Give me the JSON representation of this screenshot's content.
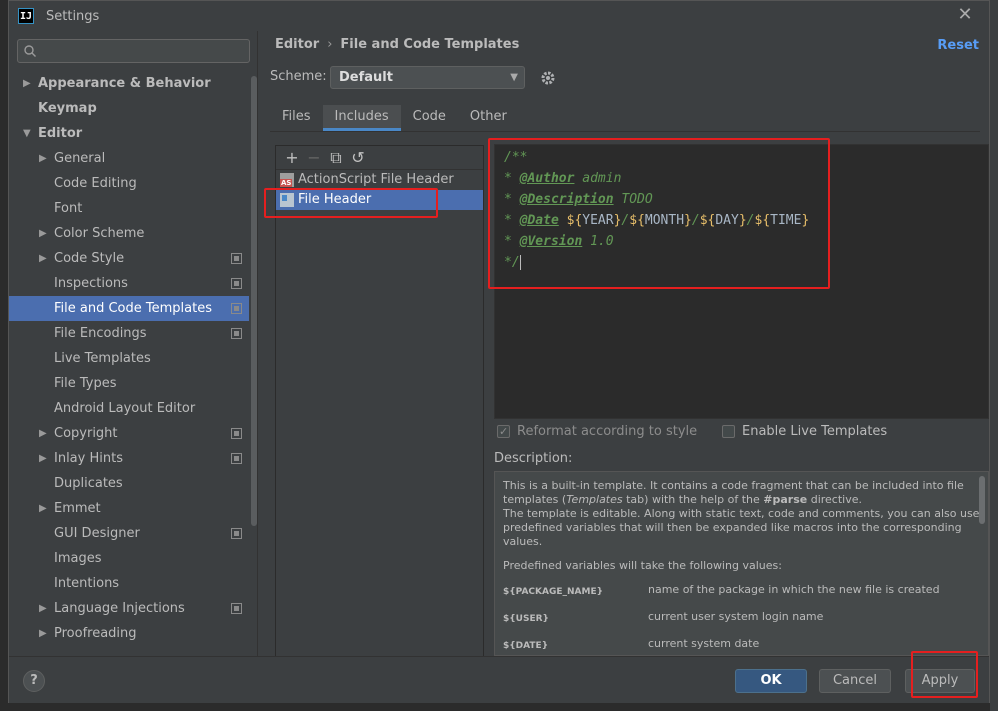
{
  "window": {
    "title": "Settings",
    "app_icon_text": "IJ"
  },
  "search": {
    "placeholder": ""
  },
  "sidebar": {
    "items": [
      {
        "label": "Appearance & Behavior",
        "level": 0,
        "arrow": "right",
        "bold": true,
        "icon": false,
        "selected": false
      },
      {
        "label": "Keymap",
        "level": 0,
        "arrow": "",
        "bold": true,
        "icon": false,
        "selected": false
      },
      {
        "label": "Editor",
        "level": 0,
        "arrow": "down",
        "bold": true,
        "icon": false,
        "selected": false
      },
      {
        "label": "General",
        "level": 1,
        "arrow": "right",
        "bold": false,
        "icon": false,
        "selected": false
      },
      {
        "label": "Code Editing",
        "level": 1,
        "arrow": "",
        "bold": false,
        "icon": false,
        "selected": false
      },
      {
        "label": "Font",
        "level": 1,
        "arrow": "",
        "bold": false,
        "icon": false,
        "selected": false
      },
      {
        "label": "Color Scheme",
        "level": 1,
        "arrow": "right",
        "bold": false,
        "icon": false,
        "selected": false
      },
      {
        "label": "Code Style",
        "level": 1,
        "arrow": "right",
        "bold": false,
        "icon": true,
        "selected": false
      },
      {
        "label": "Inspections",
        "level": 1,
        "arrow": "",
        "bold": false,
        "icon": true,
        "selected": false
      },
      {
        "label": "File and Code Templates",
        "level": 1,
        "arrow": "",
        "bold": false,
        "icon": true,
        "selected": true
      },
      {
        "label": "File Encodings",
        "level": 1,
        "arrow": "",
        "bold": false,
        "icon": true,
        "selected": false
      },
      {
        "label": "Live Templates",
        "level": 1,
        "arrow": "",
        "bold": false,
        "icon": false,
        "selected": false
      },
      {
        "label": "File Types",
        "level": 1,
        "arrow": "",
        "bold": false,
        "icon": false,
        "selected": false
      },
      {
        "label": "Android Layout Editor",
        "level": 1,
        "arrow": "",
        "bold": false,
        "icon": false,
        "selected": false
      },
      {
        "label": "Copyright",
        "level": 1,
        "arrow": "right",
        "bold": false,
        "icon": true,
        "selected": false
      },
      {
        "label": "Inlay Hints",
        "level": 1,
        "arrow": "right",
        "bold": false,
        "icon": true,
        "selected": false
      },
      {
        "label": "Duplicates",
        "level": 1,
        "arrow": "",
        "bold": false,
        "icon": false,
        "selected": false
      },
      {
        "label": "Emmet",
        "level": 1,
        "arrow": "right",
        "bold": false,
        "icon": false,
        "selected": false
      },
      {
        "label": "GUI Designer",
        "level": 1,
        "arrow": "",
        "bold": false,
        "icon": true,
        "selected": false
      },
      {
        "label": "Images",
        "level": 1,
        "arrow": "",
        "bold": false,
        "icon": false,
        "selected": false
      },
      {
        "label": "Intentions",
        "level": 1,
        "arrow": "",
        "bold": false,
        "icon": false,
        "selected": false
      },
      {
        "label": "Language Injections",
        "level": 1,
        "arrow": "right",
        "bold": false,
        "icon": true,
        "selected": false
      },
      {
        "label": "Proofreading",
        "level": 1,
        "arrow": "right",
        "bold": false,
        "icon": false,
        "selected": false
      }
    ]
  },
  "header": {
    "crumb_1": "Editor",
    "crumb_sep": "›",
    "crumb_2": "File and Code Templates",
    "reset": "Reset"
  },
  "scheme": {
    "label": "Scheme:",
    "value": "Default"
  },
  "tabs": [
    {
      "label": "Files",
      "active": false
    },
    {
      "label": "Includes",
      "active": true
    },
    {
      "label": "Code",
      "active": false
    },
    {
      "label": "Other",
      "active": false
    }
  ],
  "templates": [
    {
      "label": "ActionScript File Header",
      "icon": "actionscript-file-icon",
      "selected": false
    },
    {
      "label": "File Header",
      "icon": "file-header-icon",
      "selected": true
    }
  ],
  "editor": {
    "lines": [
      [
        {
          "t": "/**",
          "c": "c-comment"
        }
      ],
      [
        {
          "t": "* ",
          "c": "c-comment"
        },
        {
          "t": "@Author",
          "c": "c-tag"
        },
        {
          "t": " admin",
          "c": "c-comment"
        }
      ],
      [
        {
          "t": "* ",
          "c": "c-comment"
        },
        {
          "t": "@Description",
          "c": "c-tag"
        },
        {
          "t": " TODO",
          "c": "c-comment"
        }
      ],
      [
        {
          "t": "* ",
          "c": "c-comment"
        },
        {
          "t": "@Date",
          "c": "c-tag"
        },
        {
          "t": " ",
          "c": "c-comment"
        },
        {
          "t": "${",
          "c": "c-var"
        },
        {
          "t": "YEAR",
          "c": "c-plain"
        },
        {
          "t": "}",
          "c": "c-var"
        },
        {
          "t": "/",
          "c": "c-comment"
        },
        {
          "t": "${",
          "c": "c-var"
        },
        {
          "t": "MONTH",
          "c": "c-plain"
        },
        {
          "t": "}",
          "c": "c-var"
        },
        {
          "t": "/",
          "c": "c-comment"
        },
        {
          "t": "${",
          "c": "c-var"
        },
        {
          "t": "DAY",
          "c": "c-plain"
        },
        {
          "t": "}",
          "c": "c-var"
        },
        {
          "t": "/",
          "c": "c-comment"
        },
        {
          "t": "${",
          "c": "c-var"
        },
        {
          "t": "TIME",
          "c": "c-plain"
        },
        {
          "t": "}",
          "c": "c-var"
        }
      ],
      [
        {
          "t": "* ",
          "c": "c-comment"
        },
        {
          "t": "@Version",
          "c": "c-tag"
        },
        {
          "t": " 1.0",
          "c": "c-comment"
        }
      ],
      [
        {
          "t": "*/",
          "c": "c-comment"
        }
      ]
    ]
  },
  "options": {
    "reformat": "Reformat according to style",
    "reformat_checked": true,
    "live_templates": "Enable Live Templates",
    "live_templates_checked": false
  },
  "description": {
    "label": "Description:",
    "p1_a": "This is a built-in template. It contains a code fragment that can be included into file templates (",
    "p1_b": "Templates",
    "p1_c": " tab) with the help of the ",
    "p1_d": "#parse",
    "p1_e": " directive.",
    "p2": "The template is editable. Along with static text, code and comments, you can also use predefined variables that will then be expanded like macros into the corresponding values.",
    "p3": "Predefined variables will take the following values:",
    "vars": [
      {
        "name": "${PACKAGE_NAME}",
        "desc": "name of the package in which the new file is created"
      },
      {
        "name": "${USER}",
        "desc": "current user system login name"
      },
      {
        "name": "${DATE}",
        "desc": "current system date"
      }
    ]
  },
  "buttons": {
    "help": "?",
    "ok": "OK",
    "cancel": "Cancel",
    "apply": "Apply"
  },
  "colors": {
    "accent": "#4b6eaf",
    "link": "#589df6",
    "highlight": "#e51f1f"
  }
}
